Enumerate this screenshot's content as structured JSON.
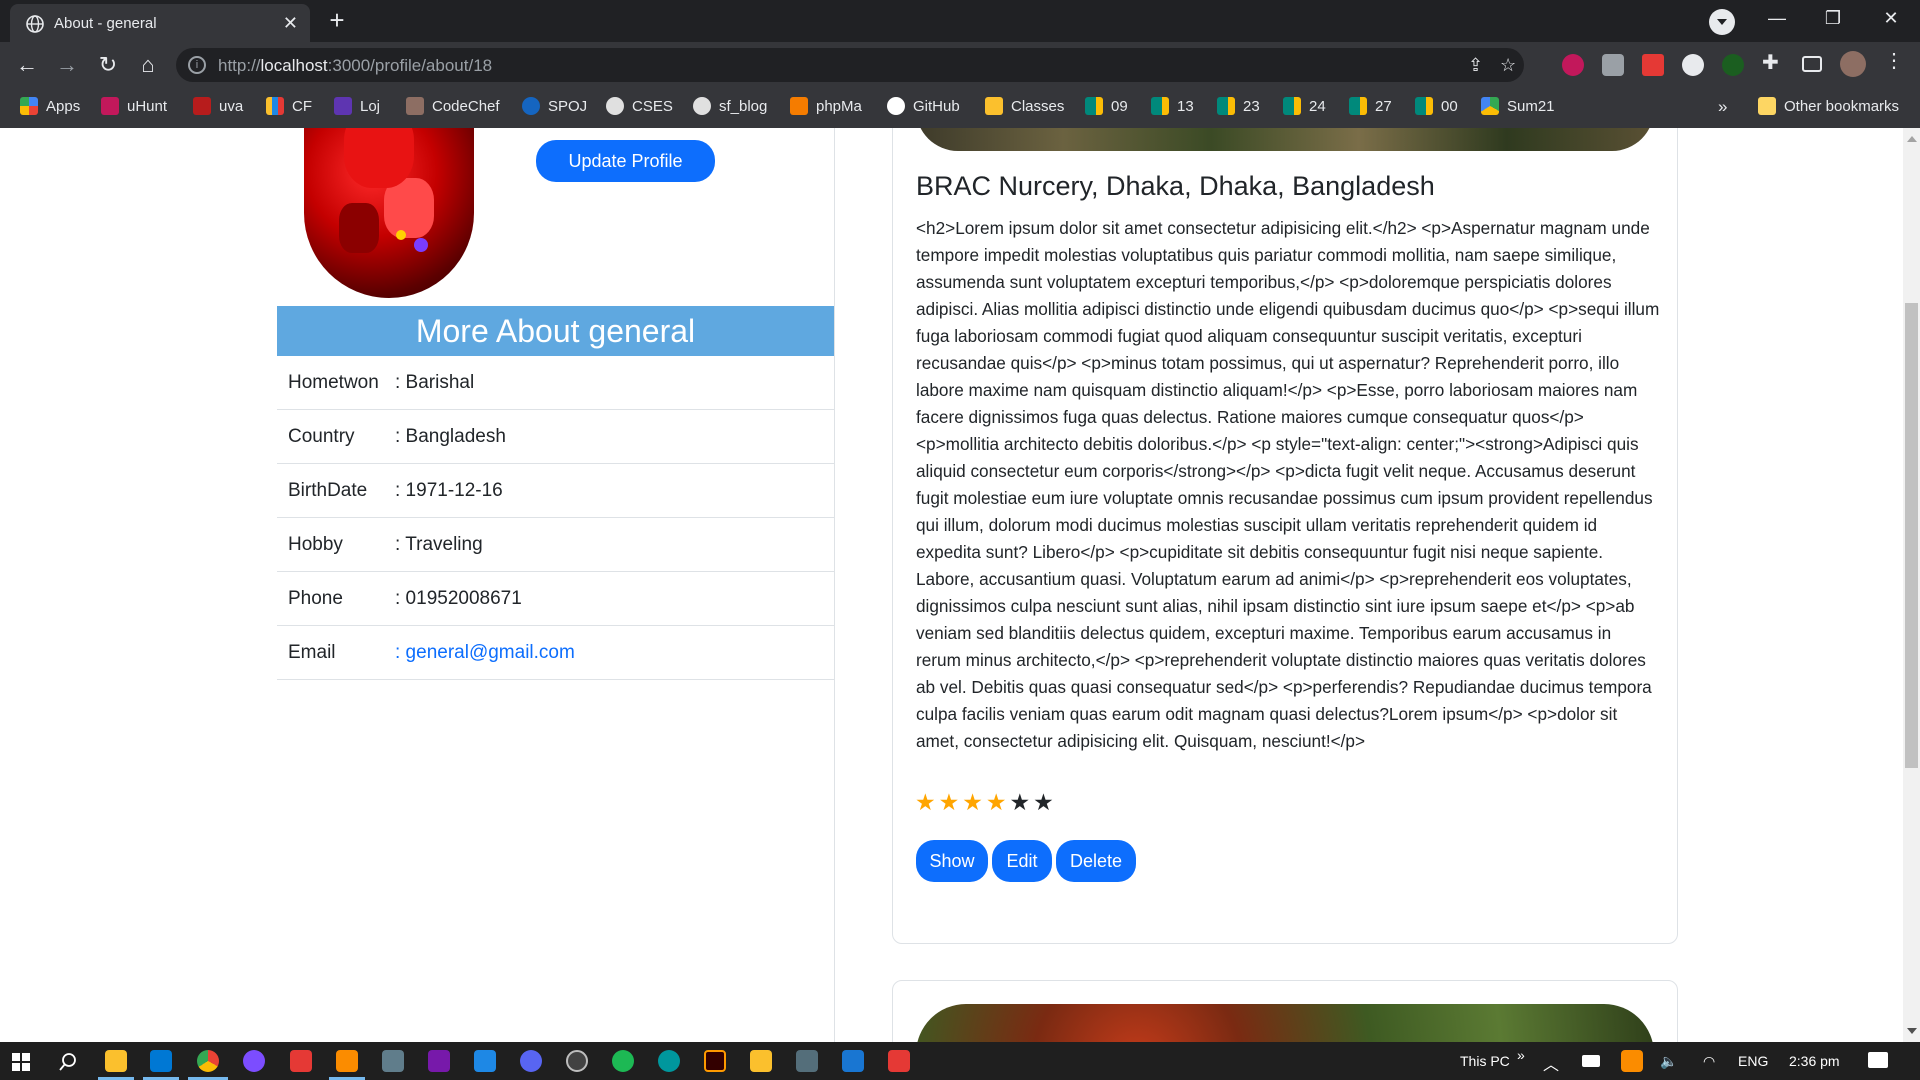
{
  "browser": {
    "tab_title": "About - general",
    "tab_close": "✕",
    "new_tab": "+",
    "url_prefix": "http://",
    "url_host": "localhost",
    "url_path": ":3000/profile/about/18",
    "window_controls": [
      "—",
      "❐",
      "✕"
    ]
  },
  "bookmarks": {
    "items": [
      {
        "label": "Apps",
        "color": "#4285f4"
      },
      {
        "label": "uHunt",
        "color": "#c2185b"
      },
      {
        "label": "uva",
        "color": "#b71c1c"
      },
      {
        "label": "CF",
        "color": "#1e88e5"
      },
      {
        "label": "Loj",
        "color": "#5e35b1"
      },
      {
        "label": "CodeChef",
        "color": "#8d6e63"
      },
      {
        "label": "SPOJ",
        "color": "#1565c0"
      },
      {
        "label": "CSES",
        "color": "#e0e0e0"
      },
      {
        "label": "sf_blog",
        "color": "#e0e0e0"
      },
      {
        "label": "phpMa",
        "color": "#f57c00"
      },
      {
        "label": "GitHub",
        "color": "#ffffff"
      },
      {
        "label": "Classes",
        "color": "#fbc02d"
      },
      {
        "label": "09",
        "color": "#00897b"
      },
      {
        "label": "13",
        "color": "#00897b"
      },
      {
        "label": "23",
        "color": "#00897b"
      },
      {
        "label": "24",
        "color": "#00897b"
      },
      {
        "label": "27",
        "color": "#00897b"
      },
      {
        "label": "00",
        "color": "#00897b"
      },
      {
        "label": "Sum21",
        "color": "#34a853"
      }
    ],
    "overflow": "»",
    "other": "Other bookmarks"
  },
  "profile": {
    "update_button": "Update Profile",
    "more_about_title": "More About general",
    "rows": [
      {
        "key": "Hometwon",
        "value": ": Barishal"
      },
      {
        "key": "Country",
        "value": ": Bangladesh"
      },
      {
        "key": "BirthDate",
        "value": ": 1971-12-16"
      },
      {
        "key": "Hobby",
        "value": ": Traveling"
      },
      {
        "key": "Phone",
        "value": ": 01952008671"
      },
      {
        "key": "Email",
        "value": ": general@gmail.com"
      }
    ]
  },
  "card": {
    "title": "BRAC Nurcery, Dhaka, Dhaka, Bangladesh",
    "text": "<h2>Lorem ipsum dolor sit amet consectetur adipisicing elit.</h2> <p>Aspernatur magnam unde tempore impedit molestias voluptatibus quis pariatur commodi mollitia, nam saepe similique, assumenda sunt voluptatem excepturi temporibus,</p> <p>doloremque perspiciatis dolores adipisci. Alias mollitia adipisci distinctio unde eligendi quibusdam ducimus quo</p> <p>sequi illum fuga laboriosam commodi fugiat quod aliquam consequuntur suscipit veritatis, excepturi recusandae quis</p> <p>minus totam possimus, qui ut aspernatur? Reprehenderit porro, illo labore maxime nam quisquam distinctio aliquam!</p> <p>Esse, porro laboriosam maiores nam facere dignissimos fuga quas delectus. Ratione maiores cumque consequatur quos</p> <p>mollitia architecto debitis doloribus.</p> <p style=\"text-align: center;\"><strong>Adipisci quis aliquid consectetur eum corporis</strong></p> <p>dicta fugit velit neque. Accusamus deserunt fugit molestiae eum iure voluptate omnis recusandae possimus cum ipsum provident repellendus qui illum, dolorum modi ducimus molestias suscipit ullam veritatis reprehenderit quidem id expedita sunt? Libero</p> <p>cupiditate sit debitis consequuntur fugit nisi neque sapiente. Labore, accusantium quasi. Voluptatum earum ad animi</p> <p>reprehenderit eos voluptates, dignissimos culpa nesciunt sunt alias, nihil ipsam distinctio sint iure ipsum saepe et</p> <p>ab veniam sed blanditiis delectus quidem, excepturi maxime. Temporibus earum accusamus in rerum minus architecto,</p> <p>reprehenderit voluptate distinctio maiores quas veritatis dolores ab vel. Debitis quas quasi consequatur sed</p> <p>perferendis? Repudiandae ducimus tempora culpa facilis veniam quas earum odit magnam quasi delectus?Lorem ipsum</p> <p>dolor sit amet, consectetur adipisicing elit. Quisquam, nesciunt!</p>",
    "rating": 4,
    "rating_max": 6,
    "buttons": {
      "show": "Show",
      "edit": "Edit",
      "delete": "Delete"
    }
  },
  "taskbar": {
    "this_pc": "This PC",
    "chevron": "»",
    "lang": "ENG",
    "time": "2:36 pm"
  },
  "colors": {
    "primary": "#0d6efd",
    "header_blue": "#5fa8e0",
    "star_on": "#ffa500",
    "star_off": "#212529"
  }
}
